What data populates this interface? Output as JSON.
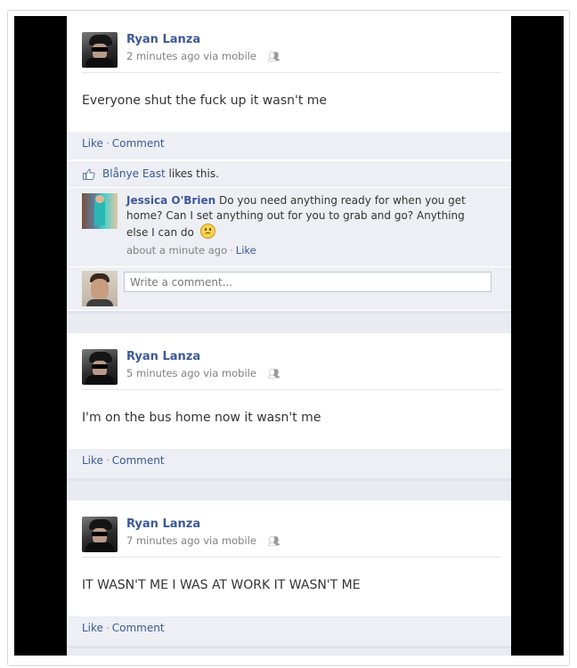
{
  "posts": [
    {
      "author": "Ryan Lanza",
      "meta": "2 minutes ago via mobile",
      "status": "Everyone shut the fuck up it wasn't me",
      "actions": {
        "like": "Like",
        "sep": "·",
        "comment": "Comment"
      },
      "likes": {
        "name": "Blånye East",
        "suffix": " likes this."
      },
      "comment": {
        "author": "Jessica O'Brien",
        "text": "Do you need anything ready for when you get home? Can I set anything out for you to grab and go? Anything else I can do",
        "time": "about a minute ago",
        "sep": "·",
        "like": "Like"
      },
      "input_placeholder": "Write a comment..."
    },
    {
      "author": "Ryan Lanza",
      "meta": "5 minutes ago via mobile",
      "status": "I'm on the bus home now it wasn't me",
      "actions": {
        "like": "Like",
        "sep": "·",
        "comment": "Comment"
      }
    },
    {
      "author": "Ryan Lanza",
      "meta": "7 minutes ago via mobile",
      "status": "IT WASN'T ME I WAS AT WORK IT WASN'T ME",
      "actions": {
        "like": "Like",
        "sep": "·",
        "comment": "Comment"
      }
    }
  ],
  "icons": {
    "audience": "friends-icon",
    "like": "thumbs-up-icon",
    "emoticon": "frown-icon"
  },
  "colors": {
    "link": "#3b5998",
    "panel": "#edeff4"
  }
}
